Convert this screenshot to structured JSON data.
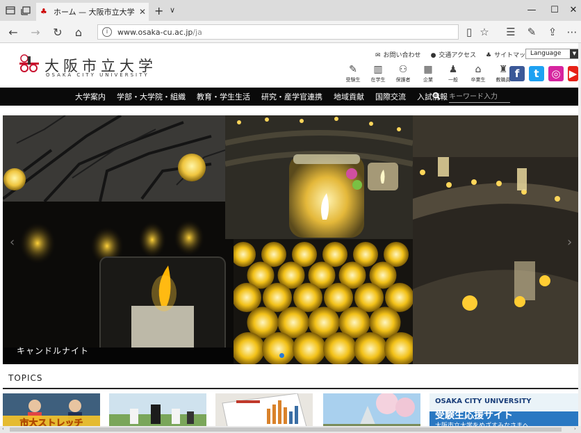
{
  "browser": {
    "tab_title": "ホーム — 大阪市立大学",
    "tab_favicon": "osaka-cu-favicon",
    "url_host": "www.osaka-cu.ac.jp",
    "url_path": "/ja"
  },
  "site": {
    "logo_jp": "大阪市立大学",
    "logo_en": "OSAKA CITY UNIVERSITY",
    "util_links": [
      {
        "icon": "mail-icon",
        "label": "お問い合わせ"
      },
      {
        "icon": "map-pin-icon",
        "label": "交通アクセス"
      },
      {
        "icon": "sitemap-icon",
        "label": "サイトマップ"
      }
    ],
    "language_label": "Language",
    "audience": [
      {
        "icon": "pen-icon",
        "label": "受験生"
      },
      {
        "icon": "books-icon",
        "label": "在学生"
      },
      {
        "icon": "family-icon",
        "label": "保護者"
      },
      {
        "icon": "building-icon",
        "label": "企業"
      },
      {
        "icon": "person-icon",
        "label": "一般"
      },
      {
        "icon": "mortarboard-icon",
        "label": "卒業生"
      },
      {
        "icon": "staff-icon",
        "label": "教職員"
      }
    ],
    "social": [
      {
        "name": "facebook",
        "glyph": "f",
        "color": "#3b5998"
      },
      {
        "name": "twitter",
        "glyph": "t",
        "color": "#1da1f2"
      },
      {
        "name": "instagram",
        "glyph": "◎",
        "color": "#d6249f"
      },
      {
        "name": "youtube",
        "glyph": "▶",
        "color": "#e62117"
      }
    ],
    "nav": [
      "大学案内",
      "学部・大学院・組織",
      "教育・学生生活",
      "研究・産学官連携",
      "地域貢献",
      "国際交流",
      "入試情報"
    ],
    "search_placeholder": "キーワード入力"
  },
  "hero": {
    "caption": "キャンドルナイト",
    "accent": "#2a7bd6"
  },
  "topics": {
    "title": "TOPICS",
    "items": [
      {
        "alt": "市大ストレッチ",
        "text": "市大ストレッチ"
      },
      {
        "alt": "sports",
        "text": ""
      },
      {
        "alt": "report",
        "text": ""
      },
      {
        "alt": "campus",
        "text": ""
      },
      {
        "alt": "受験生応援サイト",
        "text": "OSAKA CITY UNIVERSITY",
        "text2": "受験生応援サイト",
        "text3": "大阪市立大学をめざすみなさまへ"
      }
    ]
  }
}
